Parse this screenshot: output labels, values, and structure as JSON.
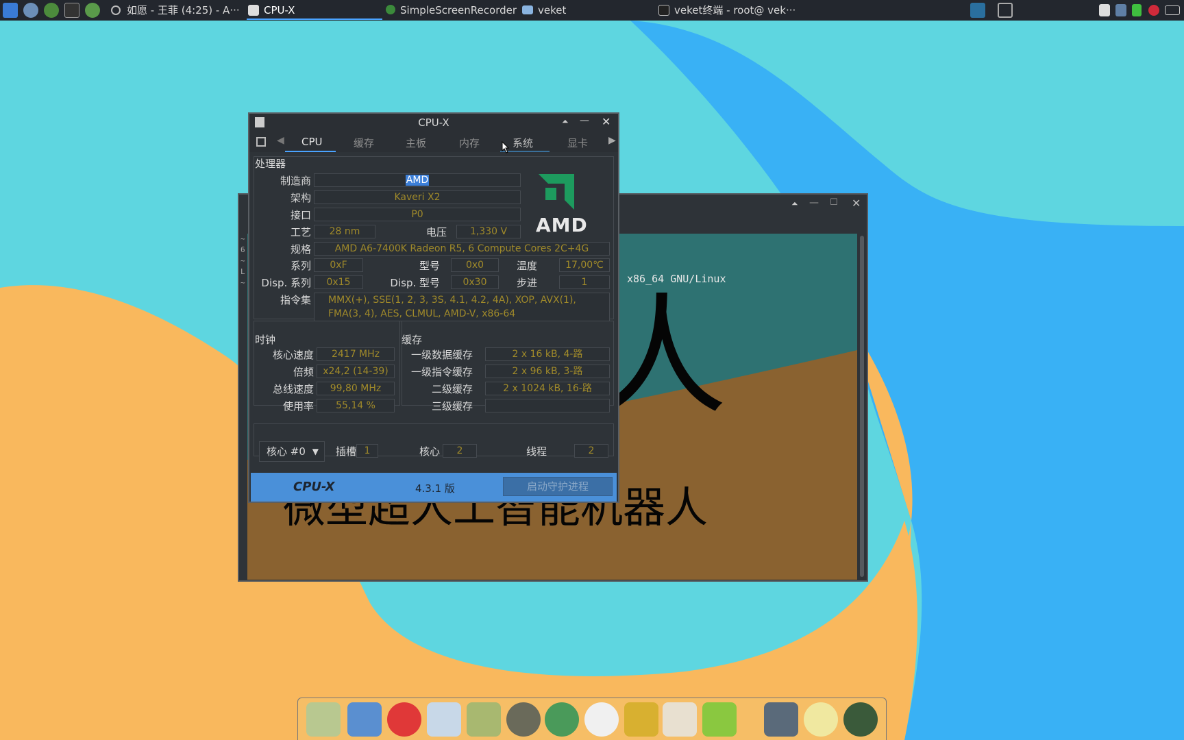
{
  "taskbar": {
    "music_title": "如愿 - 王菲 (4:25) - A···",
    "windows": [
      {
        "label": "CPU-X",
        "active": true
      },
      {
        "label": "SimpleScreenRecorder",
        "active": false
      },
      {
        "label": "veket",
        "active": false
      },
      {
        "label": "veket终端 - root@ vek···",
        "active": false
      }
    ]
  },
  "terminal": {
    "output_line": "x86_64 GNU/Linux",
    "big_char": "人",
    "big_text": "微型超人工智能机器人",
    "left_strip": [
      "~",
      "6",
      "~",
      "L",
      "~"
    ]
  },
  "cpux": {
    "title": "CPU-X",
    "tabs": [
      "CPU",
      "缓存",
      "主板",
      "内存",
      "系统",
      "显卡"
    ],
    "active_tab": "CPU",
    "processor": {
      "section": "处理器",
      "vendor_label": "制造商",
      "vendor": "AMD",
      "codename_label": "架构",
      "codename": "Kaveri X2",
      "package_label": "接口",
      "package": "P0",
      "technology_label": "工艺",
      "technology": "28 nm",
      "voltage_label": "电压",
      "voltage": "1,330 V",
      "spec_label": "规格",
      "spec": "AMD A6-7400K Radeon R5, 6 Compute Cores 2C+4G",
      "family_label": "系列",
      "family": "0xF",
      "model_label": "型号",
      "model": "0x0",
      "temp_label": "温度",
      "temp": "17,00℃",
      "disp_family_label": "Disp. 系列",
      "disp_family": "0x15",
      "disp_model_label": "Disp. 型号",
      "disp_model": "0x30",
      "stepping_label": "步进",
      "stepping": "1",
      "instructions_label": "指令集",
      "instructions": "MMX(+), SSE(1, 2, 3, 3S, 4.1, 4.2, 4A), XOP, AVX(1), FMA(3, 4), AES, CLMUL, AMD-V, x86-64",
      "logo_text": "AMD"
    },
    "clocks": {
      "section": "时钟",
      "core_speed_label": "核心速度",
      "core_speed": "2417 MHz",
      "multiplier_label": "倍频",
      "multiplier": "x24,2 (14-39)",
      "bus_speed_label": "总线速度",
      "bus_speed": "99,80 MHz",
      "usage_label": "使用率",
      "usage": "55,14 %"
    },
    "cache": {
      "section": "缓存",
      "l1d_label": "一级数据缓存",
      "l1d": "2 x 16 kB, 4-路",
      "l1i_label": "一级指令缓存",
      "l1i": "2 x 96 kB, 3-路",
      "l2_label": "二级缓存",
      "l2": "2 x 1024 kB, 16-路",
      "l3_label": "三级缓存",
      "l3": ""
    },
    "bottom": {
      "core_select": "核心 #0",
      "socket_label": "插槽",
      "socket": "1",
      "cores_label": "核心",
      "cores": "2",
      "threads_label": "线程",
      "threads": "2"
    },
    "footer": {
      "logo": "CPU-X",
      "version": "4.3.1 版",
      "daemon_button": "启动守护进程"
    }
  }
}
